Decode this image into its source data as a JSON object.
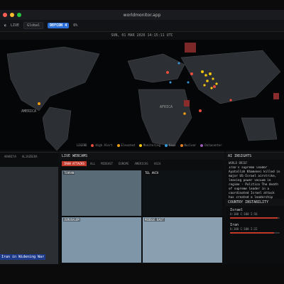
{
  "window": {
    "title": "worldmonitor.app"
  },
  "toolbar": {
    "live": "LIVE",
    "region": "Global",
    "region_badge": "DEFCON 4",
    "region_badge_suffix": "6%"
  },
  "date": "SUN, 01 MAR 2026 14:15:11 UTC",
  "map": {
    "labels": [
      {
        "text": "AMERICA"
      },
      {
        "text": "AFRICA"
      }
    ],
    "legend_title": "LEGEND",
    "legend": [
      {
        "label": "High Alert",
        "color": "#e74c3c"
      },
      {
        "label": "Elevated",
        "color": "#f39c12"
      },
      {
        "label": "Monitoring",
        "color": "#f1c40f"
      },
      {
        "label": "Base",
        "color": "#3498db"
      },
      {
        "label": "Nuclear",
        "color": "#e67e22"
      },
      {
        "label": "Datacenter",
        "color": "#9b59b6"
      }
    ]
  },
  "left_panel": {
    "tabs": [
      "ARABIYA",
      "ALJAZEERA"
    ],
    "headline": "Iran in Widening War"
  },
  "webcams": {
    "title": "LIVE WEBCAMS",
    "tabs": [
      "IRAN ATTACKS",
      "ALL",
      "MIDEAST",
      "EUROPE",
      "AMERICAS",
      "ASIA"
    ],
    "cams": [
      {
        "label": "TEHRAN"
      },
      {
        "label": "TEL AVIV"
      },
      {
        "label": "JERUSALEM"
      },
      {
        "label": "MIDDLE EAST"
      }
    ]
  },
  "ai": {
    "title": "AI INSIGHTS",
    "section": "WORLD BRIEF",
    "text": "Iran's supreme leader Ayatollah Khamenei killed in major US-Israel airstrike, leaving power vacuum in regime - Politico The death of supreme leader in a coordinated Israel attack has created a leadership crisis in Tehran."
  },
  "instability": {
    "title": "COUNTRY INSTABILITY",
    "rows": [
      {
        "country": "Israel",
        "scores": "U:100 C:100 I:56",
        "level": 0.95
      },
      {
        "country": "Iran",
        "scores": "U:100 C:100 I:22",
        "level": 0.88
      }
    ]
  }
}
